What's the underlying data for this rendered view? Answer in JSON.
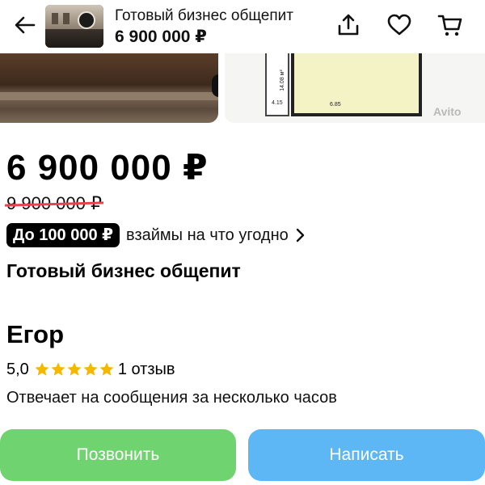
{
  "header": {
    "title": "Готовый бизнес общепит",
    "price": "6 900 000 ₽"
  },
  "gallery": {
    "plan_dim_1": "14.08 м²",
    "plan_dim_2": "4.15",
    "plan_dim_3": "6.85",
    "watermark": "Avito"
  },
  "listing": {
    "price": "6 900 000 ₽",
    "old_price": "9 900 000 ₽",
    "loan_badge": "До 100 000 ₽",
    "loan_text": "взаймы на что угодно",
    "title": "Готовый бизнес общепит"
  },
  "seller": {
    "name": "Егор",
    "rating": "5,0",
    "stars": 5,
    "reviews": "1 отзыв",
    "response_time": "Отвечает на сообщения за несколько часов"
  },
  "actions": {
    "call_label": "Позвонить",
    "write_label": "Написать"
  },
  "colors": {
    "call": "#6fd46f",
    "write": "#5cb7f4",
    "star": "#f5b800",
    "strike": "#e8434b"
  }
}
